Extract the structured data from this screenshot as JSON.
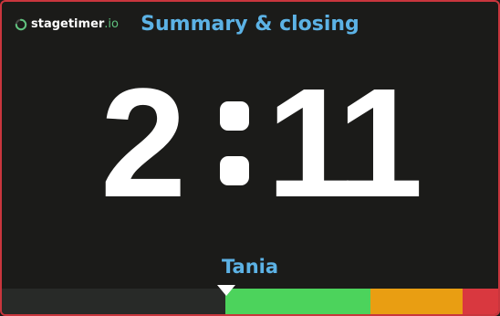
{
  "brand": {
    "name": "stagetimer",
    "tld": ".io",
    "icon": "progress-ring-icon",
    "accent": "#5fc27e"
  },
  "title": "Summary & closing",
  "timer": {
    "minutes": "2",
    "seconds": "11"
  },
  "speaker": "Tania",
  "progress": {
    "elapsed_fraction": 0.45,
    "colors": {
      "elapsed": "#282a28",
      "green": "#4cd35c",
      "orange": "#e99e12",
      "red": "#d9383f"
    }
  },
  "colors": {
    "frame_border": "#c9363d",
    "title_blue": "#5cb2e5",
    "background": "#1b1b19"
  }
}
